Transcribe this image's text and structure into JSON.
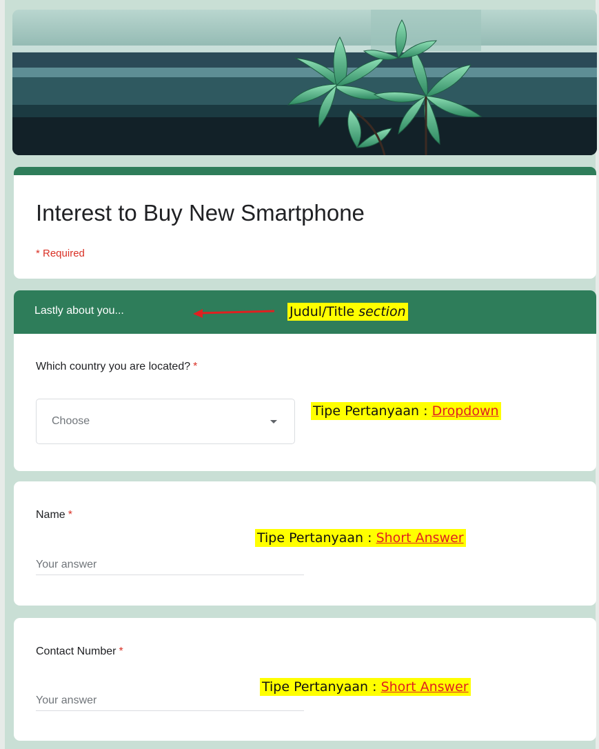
{
  "form": {
    "title": "Interest to Buy New Smartphone",
    "required_note": "* Required"
  },
  "section": {
    "title": "Lastly about you..."
  },
  "questions": [
    {
      "label": "Which country you are located?",
      "required_mark": "*",
      "type": "dropdown",
      "placeholder": "Choose"
    },
    {
      "label": "Name",
      "required_mark": "*",
      "type": "short-answer",
      "placeholder": "Your answer"
    },
    {
      "label": "Contact Number",
      "required_mark": "*",
      "type": "short-answer",
      "placeholder": "Your answer"
    }
  ],
  "annotations": {
    "section_title": {
      "prefix": "Judul/Title ",
      "emphasis": "section"
    },
    "dropdown": {
      "prefix": "Tipe Pertanyaan : ",
      "link": "Dropdown"
    },
    "short_answer_name": {
      "prefix": "Tipe Pertanyaan : ",
      "link": "Short Answer"
    },
    "short_answer_contact": {
      "prefix": "Tipe Pertanyaan : ",
      "link": "Short Answer"
    }
  },
  "colors": {
    "background": "#c9dfd5",
    "accent_green": "#2e7d5a",
    "required_red": "#d93025",
    "highlight_yellow": "#ffff00",
    "annotation_red": "#e02020"
  },
  "icons": {
    "dropdown": "chevron-down-icon",
    "arrow": "arrow-left-icon",
    "banner": "succulent-plant-image"
  }
}
